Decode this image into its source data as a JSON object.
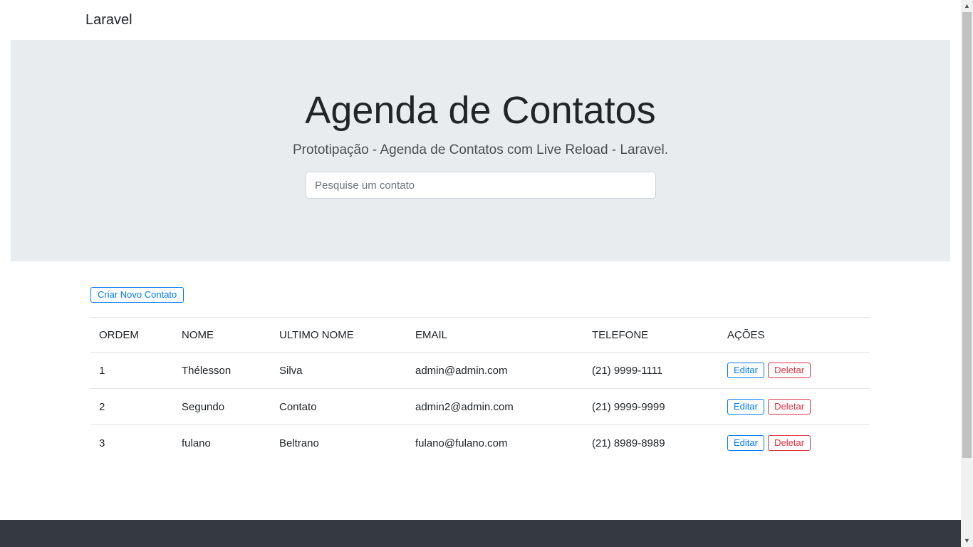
{
  "navbar": {
    "brand": "Laravel"
  },
  "hero": {
    "title": "Agenda de Contatos",
    "subtitle": "Prototipação - Agenda de Contatos com Live Reload - Laravel.",
    "search_placeholder": "Pesquise um contato"
  },
  "actions": {
    "new_contact_label": "Criar Novo Contato"
  },
  "table": {
    "headers": [
      "ORDEM",
      "NOME",
      "ULTIMO NOME",
      "EMAIL",
      "TELEFONE",
      "AÇÕES"
    ],
    "rows": [
      {
        "order": "1",
        "name": "Thélesson",
        "last_name": "Silva",
        "email": "admin@admin.com",
        "phone": "(21) 9999-1111"
      },
      {
        "order": "2",
        "name": "Segundo",
        "last_name": "Contato",
        "email": "admin2@admin.com",
        "phone": "(21) 9999-9999"
      },
      {
        "order": "3",
        "name": "fulano",
        "last_name": "Beltrano",
        "email": "fulano@fulano.com",
        "phone": "(21) 8989-8989"
      }
    ],
    "edit_label": "Editar",
    "delete_label": "Deletar"
  },
  "colors": {
    "primary": "#007bff",
    "danger": "#dc3545",
    "jumbotron_bg": "#e9ecef",
    "footer_bg": "#343a40"
  }
}
